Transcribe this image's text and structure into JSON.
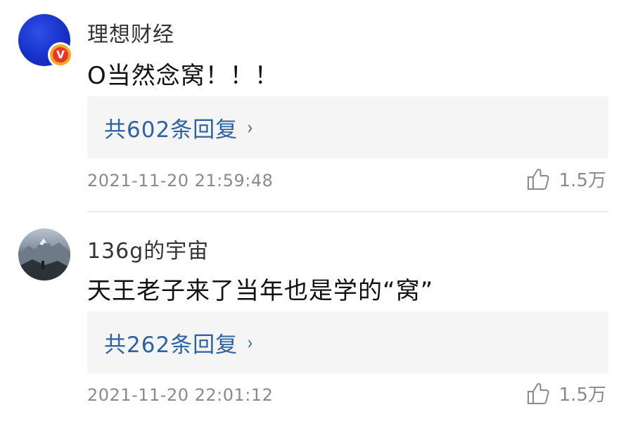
{
  "comments": [
    {
      "username": "理想财经",
      "text": "O当然念窝！！！",
      "reply_label": "共602条回复",
      "timestamp": "2021-11-20 21:59:48",
      "likes": "1.5万",
      "verified_badge": "V"
    },
    {
      "username": "136g的宇宙",
      "text": "天王老子来了当年也是学的“窝”",
      "reply_label": "共262条回复",
      "timestamp": "2021-11-20 22:01:12",
      "likes": "1.5万"
    }
  ],
  "icons": {
    "chevron": "›",
    "like": "thumbs-up-icon"
  },
  "colors": {
    "reply_link": "#2e63a3",
    "reply_box_bg": "#f5f5f5",
    "meta_text": "#8a8a8a",
    "avatar_blue": "#1631c8",
    "badge_orange": "#f5a623",
    "badge_red": "#e8362a"
  }
}
